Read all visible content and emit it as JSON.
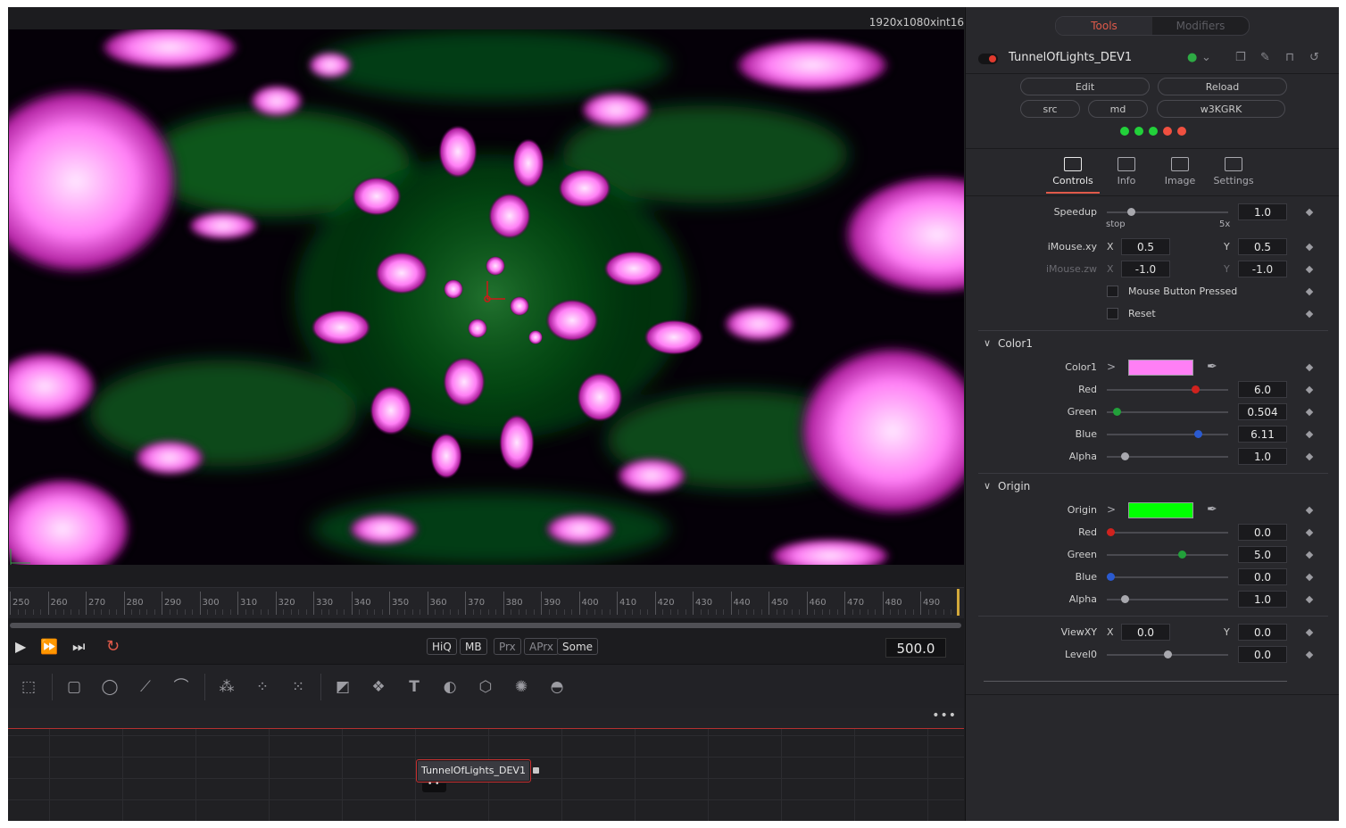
{
  "viewer": {
    "resolution": "1920x1080xint16"
  },
  "timeline": {
    "ticks": [
      "250",
      "260",
      "270",
      "280",
      "290",
      "300",
      "310",
      "320",
      "330",
      "340",
      "350",
      "360",
      "370",
      "380",
      "390",
      "400",
      "410",
      "420",
      "430",
      "440",
      "450",
      "460",
      "470",
      "480",
      "490"
    ],
    "current_frame": "500.0"
  },
  "transport": {
    "play_icon": "play-icon",
    "ffwd_icon": "fast-forward-icon",
    "end_icon": "skip-to-end-icon",
    "loop_icon": "loop-icon",
    "chips": [
      "HiQ",
      "MB",
      "Prx",
      "APrx",
      "Some"
    ]
  },
  "toolbar_icons": [
    "background-icon",
    "rectangle-mask-icon",
    "ellipse-mask-icon",
    "polygon-mask-icon",
    "bspline-mask-icon",
    "particle-emitter-icon",
    "particle-render-icon",
    "particle-icon",
    "shape3d-icon",
    "merge3d-icon",
    "text3d-icon",
    "camera3d-icon",
    "renderer3d-icon",
    "spotlight-icon",
    "imageplane3d-icon"
  ],
  "node_editor": {
    "more_label": "•••",
    "node_label": "TunnelOfLights_DEV1"
  },
  "inspector": {
    "tabs": {
      "tools": "Tools",
      "modifiers": "Modifiers"
    },
    "tool_name": "TunnelOfLights_DEV1",
    "buttons": {
      "edit": "Edit",
      "reload": "Reload",
      "src": "src",
      "md": "md",
      "code": "w3KGRK"
    },
    "leds": [
      "#22d13a",
      "#22d13a",
      "#22d13a",
      "#f05040",
      "#f05040"
    ],
    "control_tabs": [
      "Controls",
      "Info",
      "Image",
      "Settings"
    ],
    "speedup": {
      "label": "Speedup",
      "value": "1.0",
      "min_label": "stop",
      "max_label": "5x",
      "level": 0.2
    },
    "imouse_xy": {
      "label": "iMouse.xy",
      "x_label": "X",
      "x": "0.5",
      "y_label": "Y",
      "y": "0.5"
    },
    "imouse_zw": {
      "label": "iMouse.zw",
      "x_label": "X",
      "x": "-1.0",
      "y_label": "Y",
      "y": "-1.0"
    },
    "mouse_button": "Mouse Button Pressed",
    "reset": "Reset",
    "color1": {
      "section": "Color1",
      "label": "Color1",
      "swatch": "#ff7ff5",
      "red": {
        "label": "Red",
        "value": "6.0",
        "level": 0.73,
        "color": "#d0221e"
      },
      "green": {
        "label": "Green",
        "value": "0.504",
        "level": 0.08,
        "color": "#22a03a"
      },
      "blue": {
        "label": "Blue",
        "value": "6.11",
        "level": 0.75,
        "color": "#2a5ad0"
      },
      "alpha": {
        "label": "Alpha",
        "value": "1.0",
        "level": 0.15
      }
    },
    "origin": {
      "section": "Origin",
      "label": "Origin",
      "swatch": "#00ff00",
      "red": {
        "label": "Red",
        "value": "0.0",
        "level": 0.03,
        "color": "#d0221e"
      },
      "green": {
        "label": "Green",
        "value": "5.0",
        "level": 0.62,
        "color": "#22a03a"
      },
      "blue": {
        "label": "Blue",
        "value": "0.0",
        "level": 0.03,
        "color": "#2a5ad0"
      },
      "alpha": {
        "label": "Alpha",
        "value": "1.0",
        "level": 0.15
      }
    },
    "viewxy": {
      "label": "ViewXY",
      "x_label": "X",
      "x": "0.0",
      "y_label": "Y",
      "y": "0.0"
    },
    "level0": {
      "label": "Level0",
      "value": "0.0",
      "level": 0.5
    }
  }
}
